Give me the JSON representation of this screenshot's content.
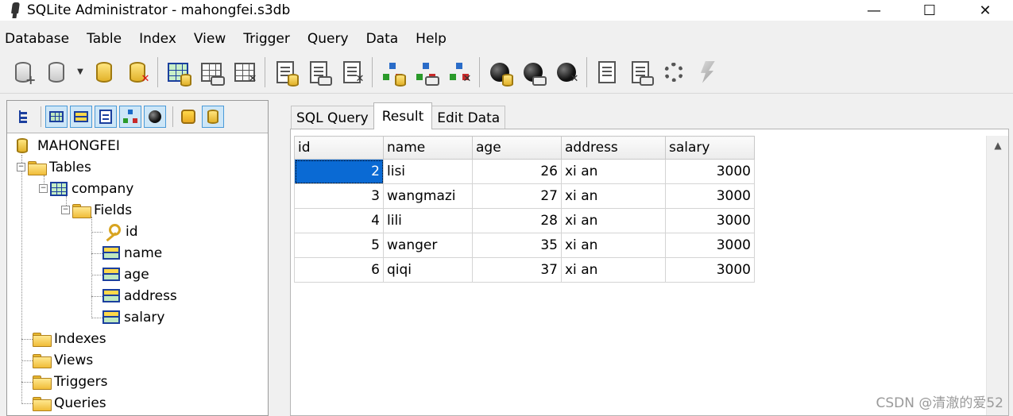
{
  "window": {
    "title": "SQLite Administrator - mahongfei.s3db",
    "minimize": "—",
    "maximize": "☐",
    "close": "✕"
  },
  "menu": [
    "Database",
    "Table",
    "Index",
    "View",
    "Trigger",
    "Query",
    "Data",
    "Help"
  ],
  "tree": {
    "root": "MAHONGFEI",
    "tables": "Tables",
    "table_name": "company",
    "fields_folder": "Fields",
    "fields": [
      "id",
      "name",
      "age",
      "address",
      "salary"
    ],
    "indexes": "Indexes",
    "views": "Views",
    "triggers": "Triggers",
    "queries": "Queries"
  },
  "tabs": {
    "sql_query": "SQL Query",
    "result": "Result",
    "edit_data": "Edit Data",
    "active": "Result"
  },
  "grid": {
    "columns": [
      "id",
      "name",
      "age",
      "address",
      "salary"
    ],
    "rows": [
      [
        "2",
        "lisi",
        "26",
        "xi an",
        "3000"
      ],
      [
        "3",
        "wangmazi",
        "27",
        "xi an",
        "3000"
      ],
      [
        "4",
        "lili",
        "28",
        "xi an",
        "3000"
      ],
      [
        "5",
        "wanger",
        "35",
        "xi an",
        "3000"
      ],
      [
        "6",
        "qiqi",
        "37",
        "xi an",
        "3000"
      ]
    ],
    "selected_cell": "row 1, column id"
  },
  "watermark": "CSDN @清澈的爱52",
  "colors": {
    "selection": "#0a6ad4",
    "folder": "#f0bc38",
    "table_icon": "#1b3f9e"
  }
}
